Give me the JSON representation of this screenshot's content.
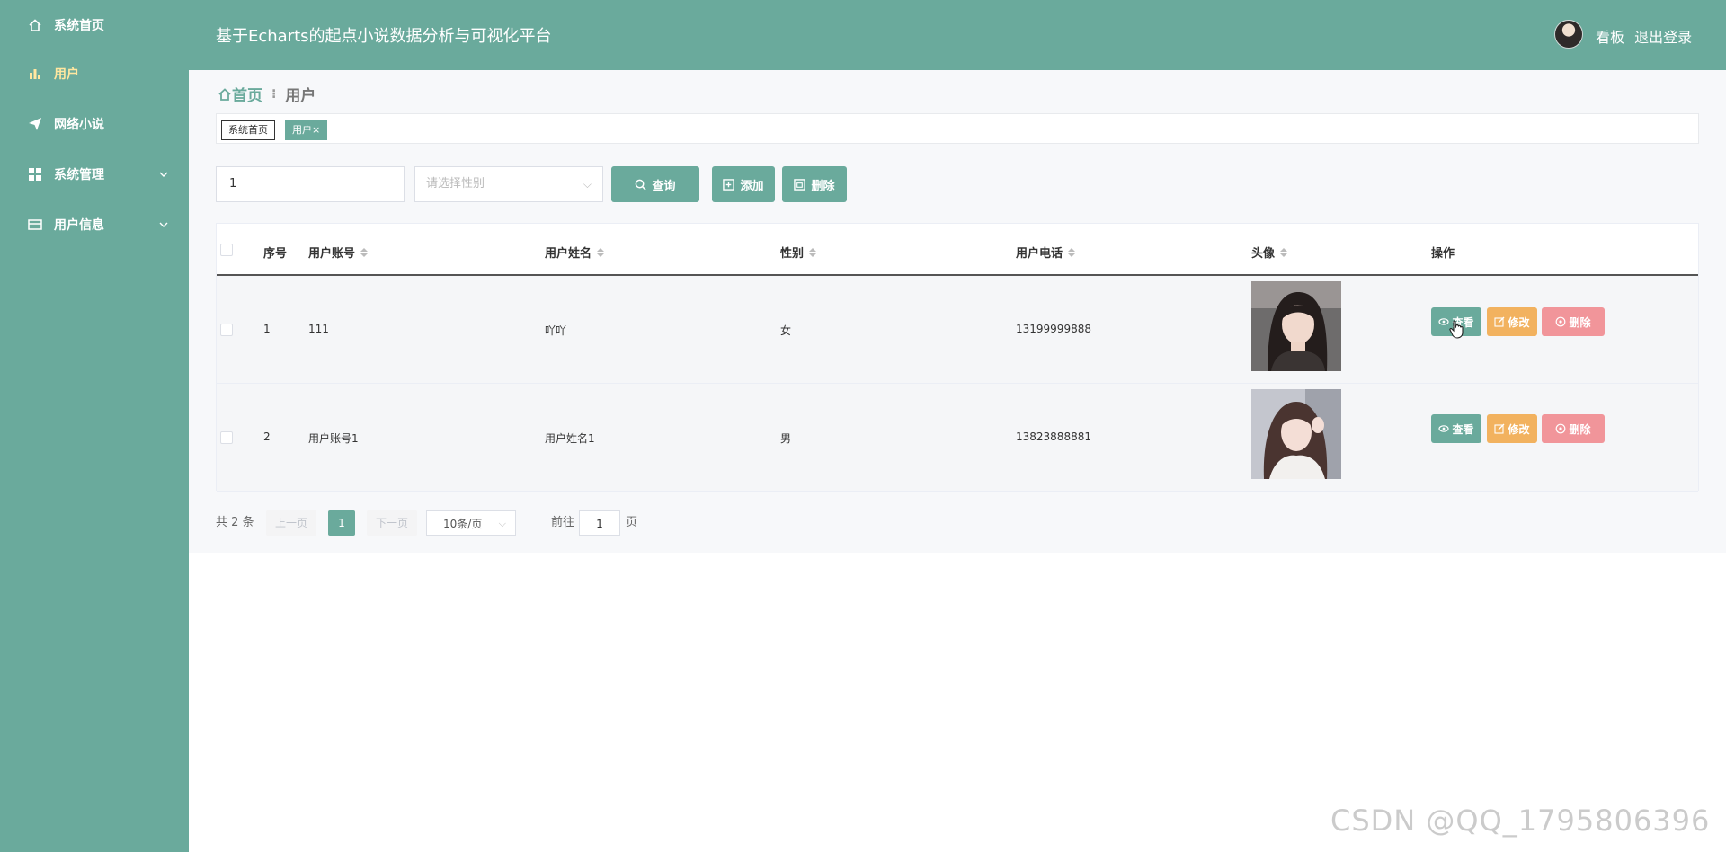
{
  "sidebar": {
    "items": [
      {
        "label": "系统首页",
        "icon": "home-icon"
      },
      {
        "label": "用户",
        "icon": "bar-chart-icon",
        "active": true
      },
      {
        "label": "网络小说",
        "icon": "paper-plane-icon"
      },
      {
        "label": "系统管理",
        "icon": "grid-icon",
        "expandable": true
      },
      {
        "label": "用户信息",
        "icon": "card-icon",
        "expandable": true
      }
    ]
  },
  "header": {
    "title": "基于Echarts的起点小说数据分析与可视化平台",
    "dashboard_link": "看板",
    "logout_link": "退出登录"
  },
  "breadcrumb": {
    "home": "首页",
    "current": "用户"
  },
  "tags": {
    "home": "系统首页",
    "current": "用户",
    "close": "×"
  },
  "search": {
    "account_value": "1",
    "gender_placeholder": "请选择性别",
    "query_label": "查询",
    "add_label": "添加",
    "delete_label": "删除"
  },
  "table": {
    "columns": [
      "序号",
      "用户账号",
      "用户姓名",
      "性别",
      "用户电话",
      "头像",
      "操作"
    ],
    "rows": [
      {
        "index": "1",
        "account": "111",
        "name": "吖吖",
        "gender": "女",
        "phone": "13199999888"
      },
      {
        "index": "2",
        "account": "用户账号1",
        "name": "用户姓名1",
        "gender": "男",
        "phone": "13823888881"
      }
    ],
    "actions": {
      "view": "查看",
      "edit": "修改",
      "delete": "删除"
    }
  },
  "pagination": {
    "total": "共 2 条",
    "prev": "上一页",
    "current_page": "1",
    "next": "下一页",
    "page_size": "10条/页",
    "goto_label": "前往",
    "goto_value": "1",
    "page_suffix": "页"
  },
  "watermark": "CSDN @QQ_1795806396",
  "colors": {
    "primary": "#6aaa9c",
    "edit": "#f2b25f",
    "delete": "#f1959a",
    "active_menu": "#ffe7a0"
  }
}
